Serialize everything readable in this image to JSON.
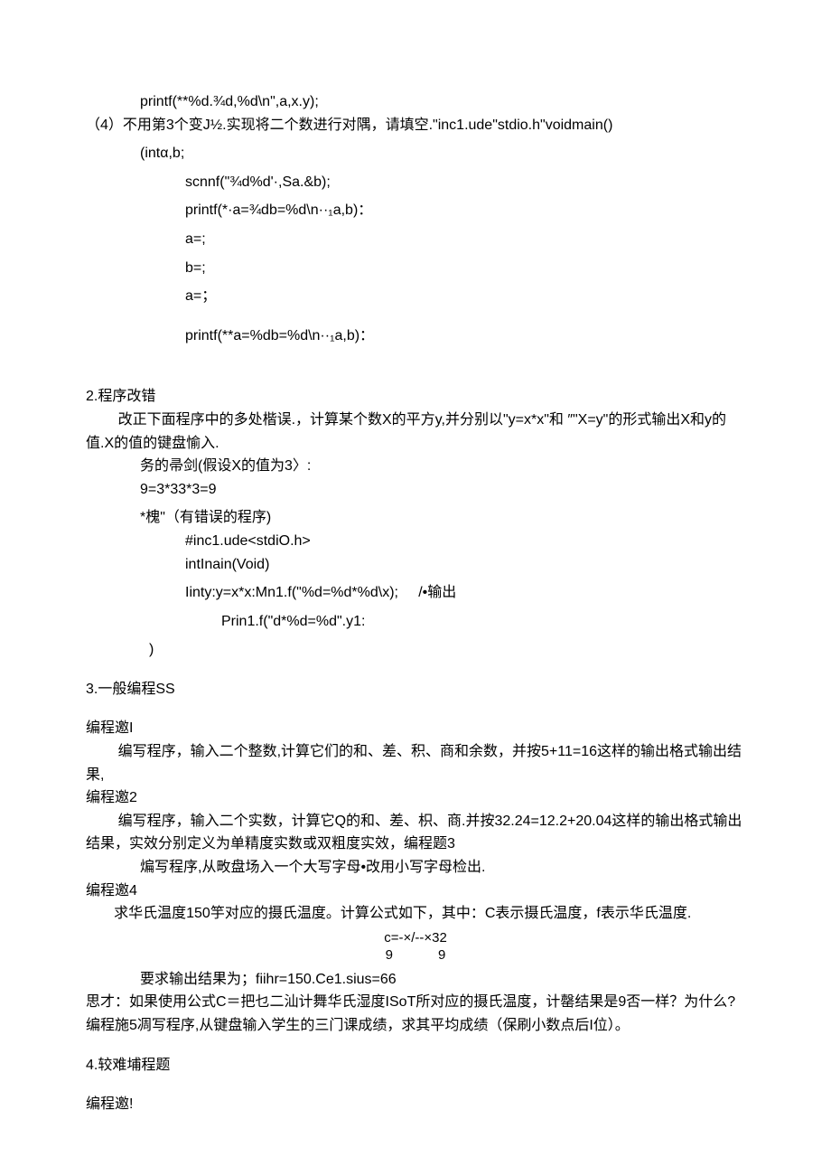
{
  "lines": {
    "l01": "printf(**%d.¾d,%d\\n\",a,x.y);",
    "l02": "（4）不用第3个变J½.实现将二个数进行对隅，请填空.\"inc1.ude\"stdio.h\"voidmain()",
    "l03": "(intα,b;",
    "l04": "scnnf(\"¾d%d'·,Sa.&b);",
    "l05": "printf(*·a=¾db=%d\\n··₁a,b)：",
    "l06": "a=;",
    "l07": "b=;",
    "l08": "a=；",
    "l09": "printf(**a=%db=%d\\n··₁a,b)：",
    "l10": "2.程序改错",
    "l11": "        改正下面程序中的多处楷误.，计算某个数X的平方y,并分别以\"y=x*x\"和 ″\"X=y\"的形式输出X和y的值.X的值的键盘愉入.",
    "l12": "务的帚剑(假设X的值为3〉:",
    "l13": "9=3*33*3=9",
    "l14": "*槐\"（有错误的程序)",
    "l15": "#inc1.ude<stdiO.h>",
    "l16": "intInain(Void)",
    "l17": "Iinty:y=x*x:Mn1.f(\"%d=%d*%d\\x);     /•输出",
    "l18": "Prin1.f(\"d*%d=%d\".y1:",
    "l19": ")",
    "l20": "3.一般编程SS",
    "l21": "编程邀I",
    "l22": "        编写程序，输入二个整数,计算它们的和、差、积、商和余数，并按5+11=16这样的输出格式输出结果,",
    "l23": "编程邀2",
    "l24": "        编写程序，输入二个实数，计算它Q的和、差、枳、商.并按32.24=12.2+20.04这样的输出格式输出结果，实效分别定义为单精度实数或双粗度实效，编程题3",
    "l25": "煸写程序,从畋盘场入一个大写字母•改用小写字母检出.",
    "l26": "编程邀4",
    "l27": "       求华氏温度150竽对应的摄氏温度。计算公式如下，其中：C表示摄氏温度，f表示华氏温度.",
    "l28a": "c=-×/--×32",
    "l28b": "9            9",
    "l29": "要求输出结果为；fiihr=150.Ce1.sius=66",
    "l30": "思才：如果使用公式C＝把乜二汕计舞华氏湿度ISoT所对应的摄氏温度，计罄结果是9否一样？为什么?",
    "l31": "编程施5凋写程序,从键盘输入学生的三门课成绩，求其平均成绩（保刷小数点后I位）。",
    "l32": "4.较难埔程题",
    "l33": "编程邀!"
  }
}
